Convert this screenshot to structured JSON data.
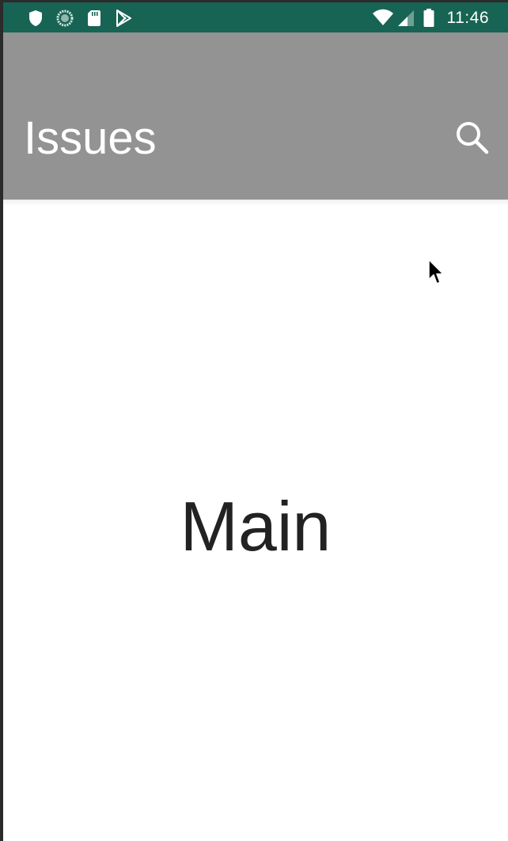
{
  "status_bar": {
    "time": "11:46",
    "left_icons": [
      "shield-icon",
      "sync-icon",
      "sd-card-icon",
      "play-store-icon"
    ],
    "right_icons": [
      "wifi-icon",
      "signal-icon",
      "battery-icon"
    ]
  },
  "app_bar": {
    "title": "Issues",
    "action_icon": "search-icon",
    "background": "#939393"
  },
  "content": {
    "label": "Main"
  },
  "colors": {
    "status_bar": "#176454",
    "app_bar": "#939393",
    "content_background": "#ffffff",
    "title_text": "#ffffff",
    "body_text": "#222222"
  }
}
